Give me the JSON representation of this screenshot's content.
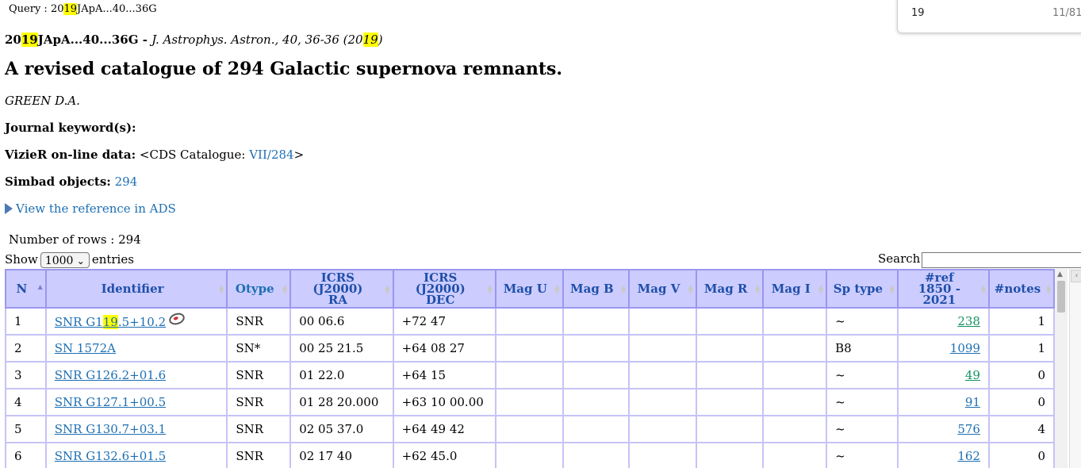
{
  "query": {
    "label": "Query : ",
    "pre": "20",
    "hl": "19",
    "post": "JApA...40...36G"
  },
  "find_bar": {
    "value": "19",
    "count": "11/81"
  },
  "bibcode": {
    "pre": "20",
    "hl": "19",
    "post": "JApA...40...36G",
    "sep": " - ",
    "journal_pre": "J. Astrophys. Astron., 40, 36-36 (20",
    "journal_hl": "19",
    "journal_post": ")"
  },
  "title": "A revised catalogue of 294 Galactic supernova remnants.",
  "author": "GREEN D.A.",
  "journal_keywords_label": "Journal keyword(s):",
  "vizier": {
    "label": "VizieR on-line data:",
    "pre": "<CDS Catalogue: ",
    "link": "VII/284",
    "post": ">"
  },
  "simbad": {
    "label": "Simbad objects:",
    "value": "294"
  },
  "ads_link": "View the reference in ADS",
  "rows_count": "Number of rows : 294",
  "length": {
    "show": "Show",
    "value": "1000",
    "entries": "entries"
  },
  "search_label": "Search:",
  "columns": {
    "n": "N",
    "identifier": "Identifier",
    "otype": "Otype",
    "ra_1": "ICRS (J2000)",
    "ra_2": "RA",
    "dec_1": "ICRS (J2000)",
    "dec_2": "DEC",
    "mag_u": "Mag U",
    "mag_b": "Mag B",
    "mag_v": "Mag V",
    "mag_r": "Mag R",
    "mag_i": "Mag I",
    "sptype": "Sp type",
    "ref_1": "#ref",
    "ref_2": "1850 - 2021",
    "notes": "#notes"
  },
  "rows": [
    {
      "n": "1",
      "id_pre": "SNR G1",
      "id_hl": "19",
      "id_post": ".5+10.2",
      "otype": "SNR",
      "ra": "00 06.6",
      "dec": "+72 47",
      "sptype": "~",
      "ref": "238",
      "notes": "1"
    },
    {
      "n": "2",
      "id": "SN 1572A",
      "otype": "SN*",
      "ra": "00 25 21.5",
      "dec": "+64 08 27",
      "sptype": "B8",
      "ref": "1099",
      "notes": "1"
    },
    {
      "n": "3",
      "id": "SNR G126.2+01.6",
      "otype": "SNR",
      "ra": "01 22.0",
      "dec": "+64 15",
      "sptype": "~",
      "ref": "49",
      "notes": "0"
    },
    {
      "n": "4",
      "id": "SNR G127.1+00.5",
      "otype": "SNR",
      "ra": "01 28 20.000",
      "dec": "+63 10 00.00",
      "sptype": "~",
      "ref": "91",
      "notes": "0"
    },
    {
      "n": "5",
      "id": "SNR G130.7+03.1",
      "otype": "SNR",
      "ra": "02 05 37.0",
      "dec": "+64 49 42",
      "sptype": "~",
      "ref": "576",
      "notes": "4"
    },
    {
      "n": "6",
      "id": "SNR G132.6+01.5",
      "otype": "SNR",
      "ra": "02 17 40",
      "dec": "+62 45.0",
      "sptype": "~",
      "ref": "162",
      "notes": "0"
    }
  ],
  "colors": {
    "header_bg": "#ccccff",
    "link": "#1d6fb2",
    "ref_green": "#14935f",
    "highlight": "#ffff00"
  }
}
